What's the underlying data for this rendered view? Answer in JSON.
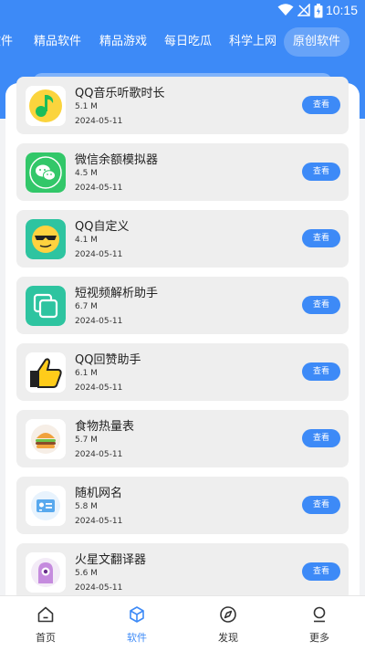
{
  "status_bar": {
    "time": "10:15"
  },
  "tabs": [
    {
      "label": "软件"
    },
    {
      "label": "精品软件"
    },
    {
      "label": "精品游戏"
    },
    {
      "label": "每日吃瓜"
    },
    {
      "label": "科学上网"
    },
    {
      "label": "原创软件",
      "active": true
    }
  ],
  "apps": [
    {
      "name": "QQ音乐听歌时长",
      "size": "5.1 M",
      "date": "2024-05-11",
      "button": "查看",
      "icon": "music-note-icon"
    },
    {
      "name": "微信余额模拟器",
      "size": "4.5 M",
      "date": "2024-05-11",
      "button": "查看",
      "icon": "wechat-icon"
    },
    {
      "name": "QQ自定义",
      "size": "4.1 M",
      "date": "2024-05-11",
      "button": "查看",
      "icon": "sunglasses-face-icon"
    },
    {
      "name": "短视频解析助手",
      "size": "6.7 M",
      "date": "2024-05-11",
      "button": "查看",
      "icon": "copy-squares-icon"
    },
    {
      "name": "QQ回赞助手",
      "size": "6.1 M",
      "date": "2024-05-11",
      "button": "查看",
      "icon": "thumbs-up-icon"
    },
    {
      "name": "食物热量表",
      "size": "5.7 M",
      "date": "2024-05-11",
      "button": "查看",
      "icon": "burger-icon"
    },
    {
      "name": "随机网名",
      "size": "5.8 M",
      "date": "2024-05-11",
      "button": "查看",
      "icon": "id-card-icon"
    },
    {
      "name": "火星文翻译器",
      "size": "5.6 M",
      "date": "2024-05-11",
      "button": "查看",
      "icon": "one-eyed-monster-icon"
    }
  ],
  "bottom_nav": [
    {
      "label": "首页",
      "icon": "home-icon"
    },
    {
      "label": "软件",
      "icon": "cube-icon",
      "active": true
    },
    {
      "label": "发现",
      "icon": "compass-icon"
    },
    {
      "label": "更多",
      "icon": "profile-icon"
    }
  ],
  "colors": {
    "primary": "#3d8af7",
    "card": "#eeeeee",
    "background": "#f2f3f5"
  }
}
